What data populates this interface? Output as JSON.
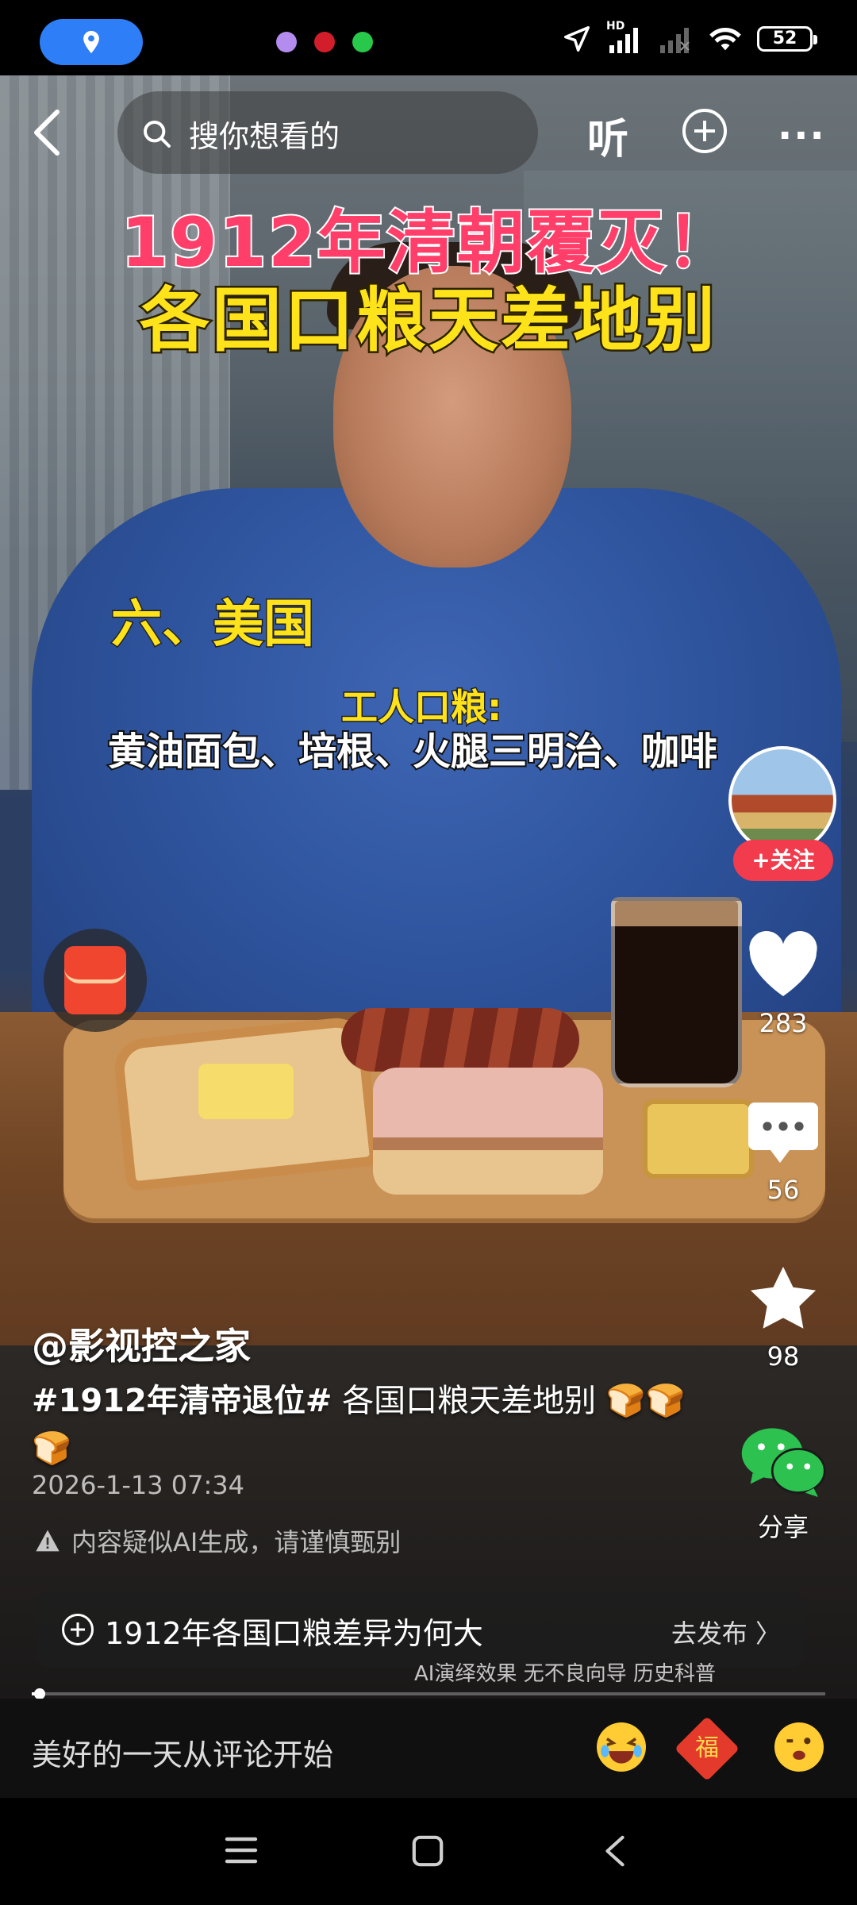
{
  "status_bar": {
    "battery": "52",
    "network_label": "HD",
    "app_dot_colors": [
      "#b48cf0",
      "#d21e2a",
      "#28c84a"
    ],
    "location_pill_color": "#2d7ef7"
  },
  "top_nav": {
    "search_placeholder": "搜你想看的",
    "listen_label": "听"
  },
  "video_overlay": {
    "headline_line1": "1912年清朝覆灭！",
    "headline_line2": "各国口粮天差地别",
    "country": "六、美国",
    "ration_label": "工人口粮:",
    "foods": "黄油面包、培根、火腿三明治、咖啡"
  },
  "right_rail": {
    "follow_label": "+关注",
    "likes": "283",
    "comments": "56",
    "favorites": "98",
    "share_label": "分享"
  },
  "post": {
    "author": "@影视控之家",
    "hashtag": "#1912年清帝退位#",
    "caption": " 各国口粮天差地别 🍞🍞🍞",
    "datetime": "2026-1-13 07:34",
    "ai_warning": "内容疑似AI生成，请谨慎甄别",
    "topic_text": "1912年各国口粮差异为何大",
    "topic_action": "去发布 〉",
    "disclaimer": "AI演绎效果 无不良向导 历史科普",
    "progress": 0.01
  },
  "comment_bar": {
    "prompt": "美好的一天从评论开始",
    "emoji_fu": "福"
  },
  "accent_colors": {
    "follow_red": "#f23b4c",
    "headline_pink": "#ff3f6a",
    "headline_yellow": "#ffe31a",
    "wechat_green": "#2dc150"
  }
}
